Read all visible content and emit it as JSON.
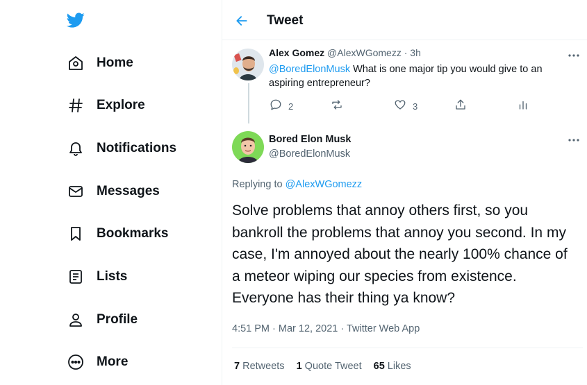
{
  "logo": {
    "icon": "twitter-bird-icon",
    "color": "#1d9bf0"
  },
  "nav": {
    "items": [
      {
        "id": "home",
        "label": "Home",
        "icon": "home-icon"
      },
      {
        "id": "explore",
        "label": "Explore",
        "icon": "hashtag-icon"
      },
      {
        "id": "notifications",
        "label": "Notifications",
        "icon": "bell-icon"
      },
      {
        "id": "messages",
        "label": "Messages",
        "icon": "mail-icon"
      },
      {
        "id": "bookmarks",
        "label": "Bookmarks",
        "icon": "bookmark-icon"
      },
      {
        "id": "lists",
        "label": "Lists",
        "icon": "list-icon"
      },
      {
        "id": "profile",
        "label": "Profile",
        "icon": "person-icon"
      },
      {
        "id": "more",
        "label": "More",
        "icon": "more-circle-icon"
      }
    ]
  },
  "header": {
    "back_icon": "back-arrow-icon",
    "title": "Tweet"
  },
  "parent_tweet": {
    "name": "Alex Gomez",
    "handle": "@AlexWGomezz",
    "separator": "·",
    "time": "3h",
    "mention": "@BoredElonMusk",
    "text": " What is one major tip you would give to an aspiring entrepreneur?",
    "replies": "2",
    "retweets": "",
    "likes": "3"
  },
  "tweet": {
    "name": "Bored Elon Musk",
    "handle": "@BoredElonMusk",
    "replying_prefix": "Replying to ",
    "replying_to": "@AlexWGomezz",
    "text": "Solve problems that annoy others first, so you bankroll the problems that annoy you second. In my case, I'm annoyed about the nearly 100% chance of a meteor wiping our species from existence. Everyone has their thing ya know?",
    "timestamp": "4:51 PM · Mar 12, 2021 · Twitter Web App",
    "stats": {
      "retweets_count": "7",
      "retweets_label": "Retweets",
      "quotes_count": "1",
      "quotes_label": "Quote Tweet",
      "likes_count": "65",
      "likes_label": "Likes"
    }
  },
  "colors": {
    "accent": "#1d9bf0",
    "text": "#0f1419",
    "secondary": "#536471",
    "border": "#eff3f4"
  }
}
